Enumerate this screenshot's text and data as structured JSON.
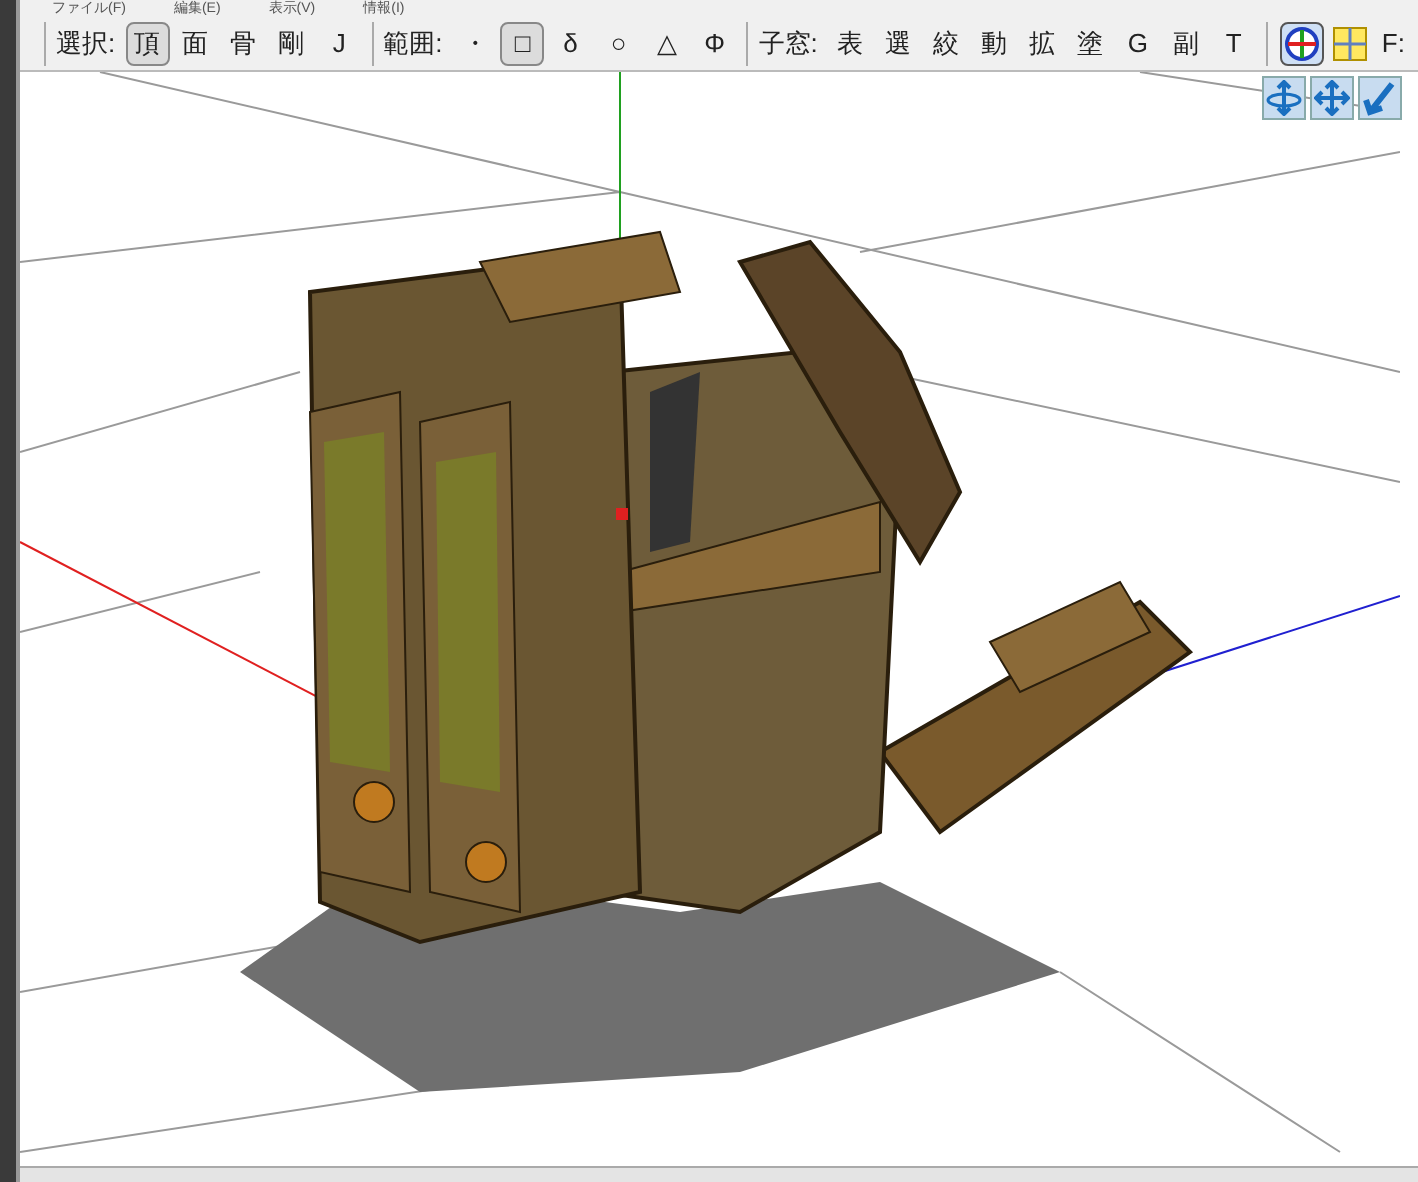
{
  "menu": [
    {
      "label": "ファイル(F)"
    },
    {
      "label": "編集(E)"
    },
    {
      "label": "表示(V)"
    },
    {
      "label": "情報(I)"
    }
  ],
  "toolbar_groups": [
    {
      "label": "選択:",
      "buttons": [
        {
          "label": "頂",
          "selected": true
        },
        {
          "label": "面",
          "selected": false
        },
        {
          "label": "骨",
          "selected": false
        },
        {
          "label": "剛",
          "selected": false
        },
        {
          "label": "J",
          "selected": false
        }
      ]
    },
    {
      "label": "範囲:",
      "buttons": [
        {
          "label": "・",
          "selected": false
        },
        {
          "label": "□",
          "selected": true
        },
        {
          "label": "δ",
          "selected": false
        },
        {
          "label": "○",
          "selected": false
        },
        {
          "label": "△",
          "selected": false
        },
        {
          "label": "Φ",
          "selected": false
        }
      ]
    },
    {
      "label": "子窓:",
      "buttons": [
        {
          "label": "表",
          "selected": false
        },
        {
          "label": "選",
          "selected": false
        },
        {
          "label": "絞",
          "selected": false
        },
        {
          "label": "動",
          "selected": false
        },
        {
          "label": "拡",
          "selected": false
        },
        {
          "label": "塗",
          "selected": false
        },
        {
          "label": "G",
          "selected": false
        },
        {
          "label": "副",
          "selected": false
        },
        {
          "label": "T",
          "selected": false
        }
      ]
    }
  ],
  "view_buttons": [
    {
      "kind": "axis",
      "selected": true
    },
    {
      "kind": "quad",
      "selected": false
    }
  ],
  "toolbar_cut_text": "F:"
}
